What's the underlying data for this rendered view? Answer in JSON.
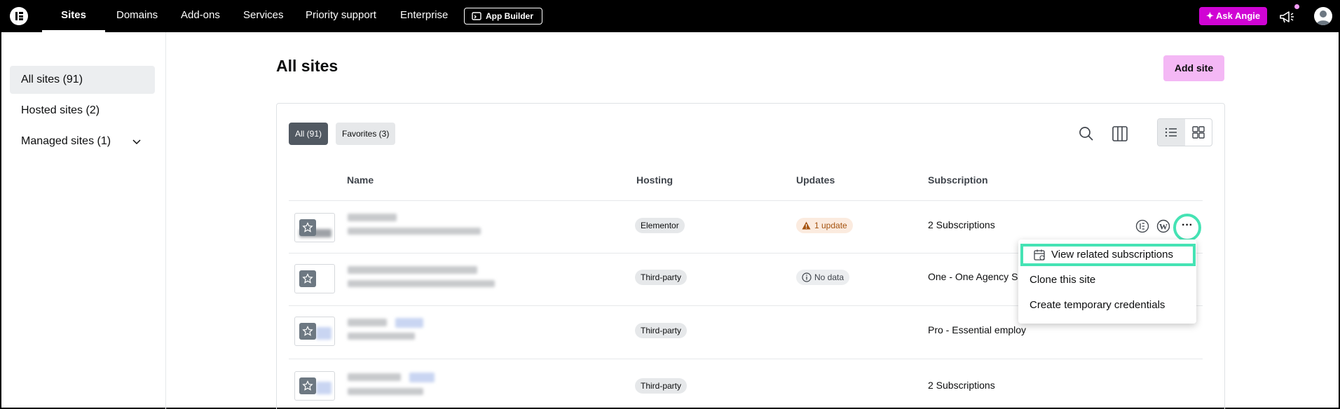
{
  "topnav": {
    "logo": "elementor-logo",
    "items": [
      {
        "label": "Sites",
        "active": true
      },
      {
        "label": "Domains"
      },
      {
        "label": "Add-ons"
      },
      {
        "label": "Services"
      },
      {
        "label": "Priority support"
      },
      {
        "label": "Enterprise"
      }
    ],
    "app_builder_label": "App Builder",
    "ask_angie_label": "✦ Ask Angie",
    "accent_color": "#d004d4"
  },
  "sidebar": {
    "items": [
      {
        "label": "All sites (91)",
        "active": true
      },
      {
        "label": "Hosted sites (2)"
      },
      {
        "label": "Managed sites (1)"
      }
    ]
  },
  "main": {
    "title": "All sites",
    "add_site_label": "Add site",
    "filters": [
      {
        "label": "All (91)",
        "active": true
      },
      {
        "label": "Favorites (3)"
      }
    ],
    "columns": [
      "Name",
      "Hosting",
      "Updates",
      "Subscription"
    ],
    "rows": [
      {
        "hosting": "Elementor",
        "updates": "1 update",
        "subscription": "2 Subscriptions"
      },
      {
        "hosting": "Third-party",
        "updates": "No data",
        "subscription": "One - One Agency Sc"
      },
      {
        "hosting": "Third-party",
        "updates": "",
        "subscription": "Pro - Essential employ"
      },
      {
        "hosting": "Third-party",
        "updates": "",
        "subscription": "2 Subscriptions"
      }
    ]
  },
  "menu": {
    "items": [
      {
        "label": "View related subscriptions",
        "highlighted": true
      },
      {
        "label": "Clone this site"
      },
      {
        "label": "Create temporary credentials"
      }
    ],
    "highlight_color": "#45e3b4"
  }
}
